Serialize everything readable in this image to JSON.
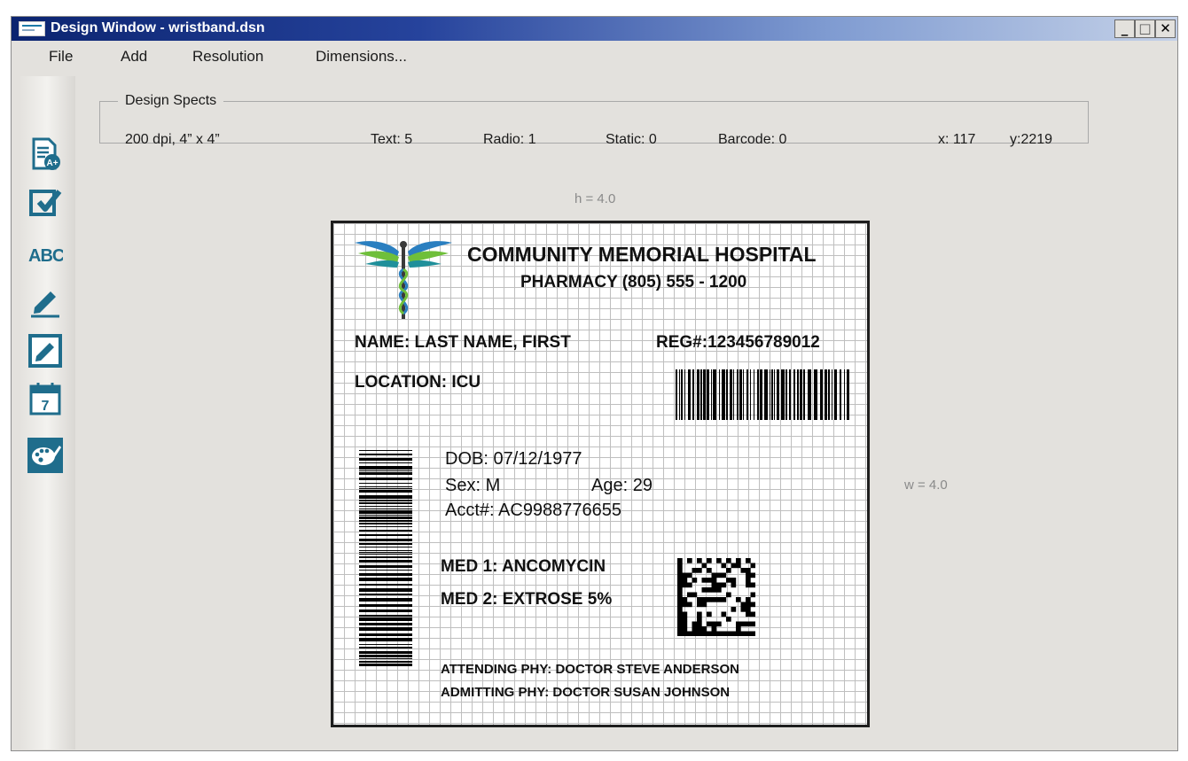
{
  "window": {
    "title": "Design Window - wristband.dsn",
    "controls": {
      "minimize": "_",
      "maximize": "□",
      "close": "✕"
    }
  },
  "menu": {
    "file": "File",
    "add": "Add",
    "resolution": "Resolution",
    "dimensions": "Dimensions..."
  },
  "toolbar": {
    "icons": [
      "document-add-icon",
      "checkbox-icon",
      "text-abc-icon",
      "edit-pencil-icon",
      "edit-box-icon",
      "calendar-icon",
      "palette-icon"
    ],
    "abc_text": "ABC",
    "calendar_day": "7",
    "add_badge": "A+"
  },
  "specs": {
    "legend": "Design Spects",
    "resolution": "200 dpi, 4” x  4”",
    "text": "Text: 5",
    "radio": "Radio: 1",
    "static": "Static: 0",
    "barcode": "Barcode: 0",
    "x": "x: 117",
    "y": "y:2219"
  },
  "dimensions": {
    "height": "h = 4.0",
    "width": "w = 4.0"
  },
  "label": {
    "hospital": "COMMUNITY MEMORIAL HOSPITAL",
    "pharmacy": "PHARMACY (805) 555 - 1200",
    "name": "NAME: LAST NAME, FIRST",
    "reg": "REG#:123456789012",
    "location": "LOCATION: ICU",
    "dob": "DOB: 07/12/1977",
    "sex": "Sex: M",
    "age": "Age: 29",
    "acct": "Acct#: AC9988776655",
    "med1": "MED 1: ANCOMYCIN",
    "med2": "MED 2: EXTROSE 5%",
    "attending": "ATTENDING PHY: DOCTOR STEVE ANDERSON",
    "admitting": "ADMITTING PHY: DOCTOR SUSAN JOHNSON"
  },
  "colors": {
    "titlebar_dark": "#0b2470",
    "titlebar_light": "#c4d1e8",
    "toolbar_icon": "#1f6d8c",
    "logo_blue": "#2a7fc0",
    "logo_green": "#6fbf3a",
    "logo_teal": "#1f8f9a"
  }
}
